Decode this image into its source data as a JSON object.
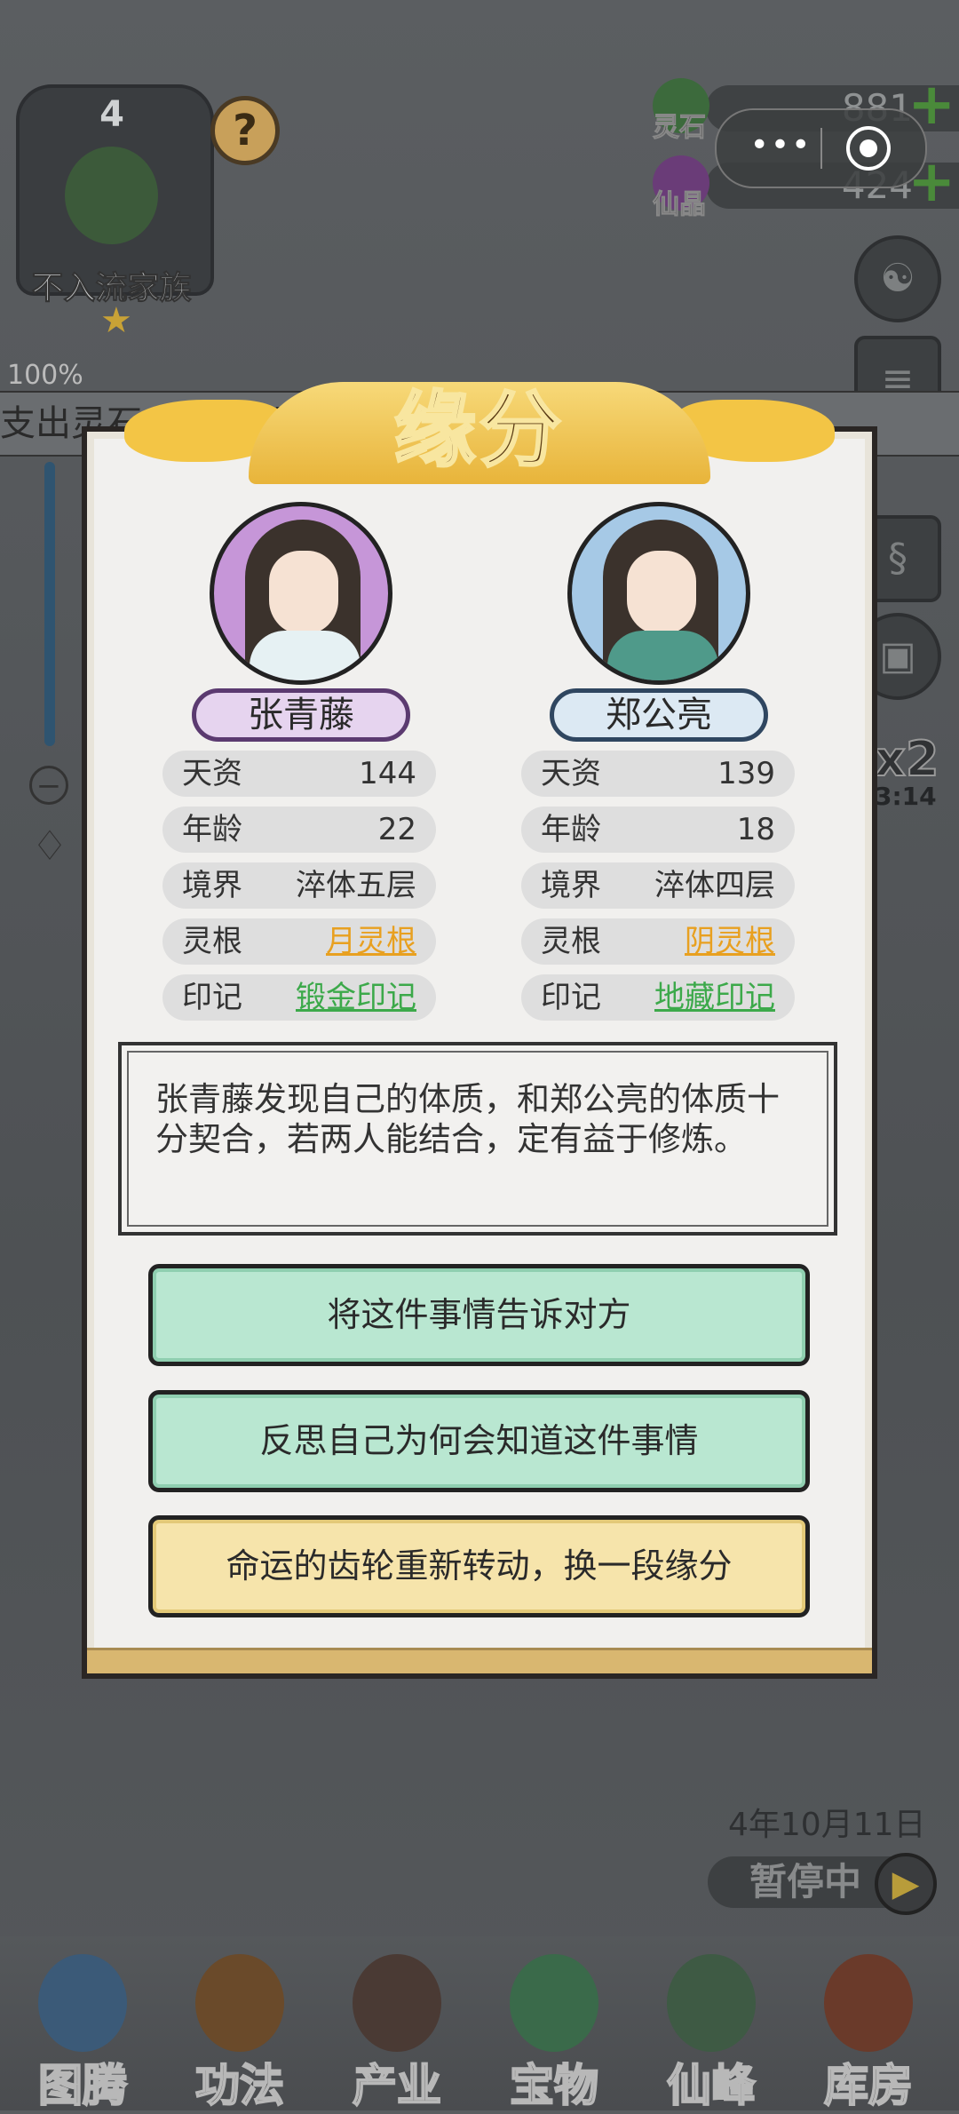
{
  "hud": {
    "family_level": "4",
    "family_name": "不入流家族",
    "progress_text": "100%",
    "help": "?",
    "notice_text": "支出灵石      在出      会灵石",
    "resources": [
      {
        "label": "灵石",
        "value": "881"
      },
      {
        "label": "仙晶",
        "value": "424"
      }
    ],
    "speed_multiplier": "x2",
    "speed_timer": "3:14"
  },
  "capsule": {
    "menu": "•••"
  },
  "modal": {
    "title": "缘分",
    "left": {
      "name": "张青藤",
      "stats": [
        {
          "key": "天资",
          "value": "144"
        },
        {
          "key": "年龄",
          "value": "22"
        },
        {
          "key": "境界",
          "value": "淬体五层"
        },
        {
          "key": "灵根",
          "value": "月灵根"
        },
        {
          "key": "印记",
          "value": "锻金印记"
        }
      ]
    },
    "right": {
      "name": "郑公亮",
      "stats": [
        {
          "key": "天资",
          "value": "139"
        },
        {
          "key": "年龄",
          "value": "18"
        },
        {
          "key": "境界",
          "value": "淬体四层"
        },
        {
          "key": "灵根",
          "value": "阴灵根"
        },
        {
          "key": "印记",
          "value": "地藏印记"
        }
      ]
    },
    "description": "张青藤发现自己的体质，和郑公亮的体质十分契合，若两人能结合，定有益于修炼。",
    "options": [
      "将这件事情告诉对方",
      "反思自己为何会知道这件事情",
      "命运的齿轮重新转动，换一段缘分"
    ]
  },
  "footer": {
    "date": "4年10月11日",
    "pause_label": "暂停中",
    "nav": [
      "图腾",
      "功法",
      "产业",
      "宝物",
      "仙峰",
      "库房"
    ]
  },
  "colors": {
    "accent_orange": "#e8a020",
    "accent_green": "#3ca94a",
    "button_green": "#b9e7d1",
    "button_yellow": "#f6e4ab"
  }
}
